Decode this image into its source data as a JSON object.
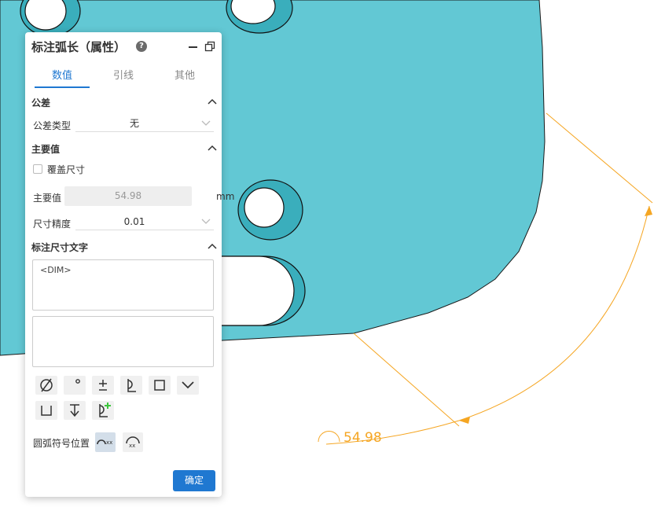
{
  "panel": {
    "title": "标注弧长（属性）",
    "help_icon": "?",
    "tabs": [
      "数值",
      "引线",
      "其他"
    ],
    "active_tab": 0
  },
  "tolerance": {
    "section_title": "公差",
    "type_label": "公差类型",
    "type_value": "无"
  },
  "main_value": {
    "section_title": "主要值",
    "override_label": "覆盖尺寸",
    "override_checked": false,
    "value_label": "主要值",
    "value": "54.98",
    "unit": "mm",
    "precision_label": "尺寸精度",
    "precision_value": "0.01"
  },
  "dim_text": {
    "section_title": "标注尺寸文字",
    "text_value": "<DIM>",
    "second_text_value": ""
  },
  "symbols": [
    "diameter-icon",
    "degree-icon",
    "plus-minus-icon",
    "centerline-icon",
    "square-icon",
    "chevron-down-icon",
    "counterbore-icon",
    "depth-icon",
    "add-centerline-icon"
  ],
  "arc_symbol": {
    "label": "圆弧符号位置",
    "options": [
      "arc-symbol-before-icon",
      "arc-symbol-above-icon"
    ],
    "selected": 0,
    "option_text": "xx"
  },
  "confirm_label": "确定",
  "viewport": {
    "dimension_text": "54.98",
    "part_color": "#62c8d4",
    "dimension_color": "#f5a623"
  }
}
